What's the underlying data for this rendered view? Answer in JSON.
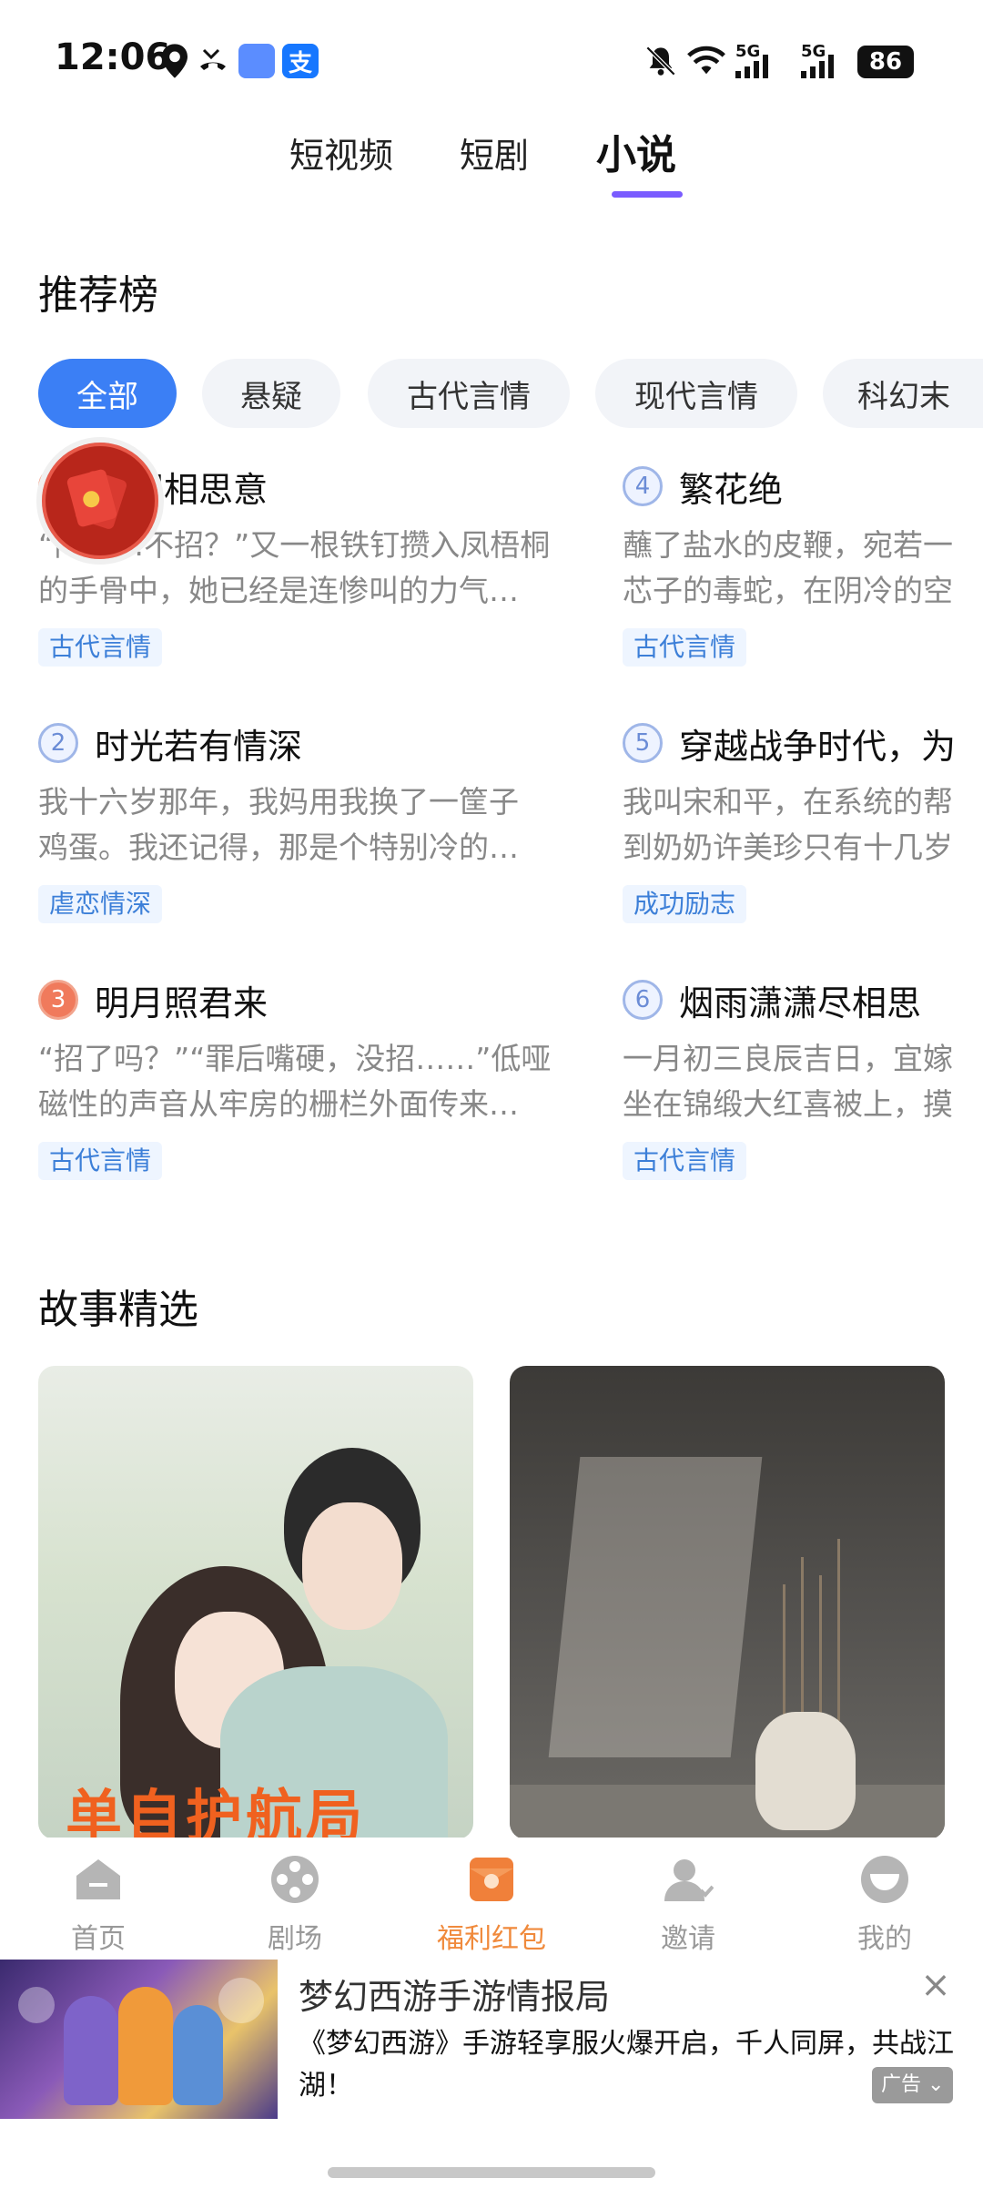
{
  "status_bar": {
    "time": "12:06",
    "net1": "5G",
    "net2": "5G",
    "battery": "86",
    "pay_icon_label": "支"
  },
  "top_tabs": [
    {
      "label": "短视频",
      "active": false
    },
    {
      "label": "短剧",
      "active": false
    },
    {
      "label": "小说",
      "active": true
    }
  ],
  "ranking": {
    "title": "推荐榜",
    "chips": [
      "全部",
      "悬疑",
      "古代言情",
      "现代言情",
      "科幻末"
    ],
    "active_chip": 0,
    "items": [
      {
        "rank": "1",
        "title": "此间相思意",
        "desc": [
          "“问……不招？”又一根铁钉攒入凤梧桐",
          "的手骨中，她已经是连惨叫的力气…"
        ],
        "tag": "古代言情"
      },
      {
        "rank": "2",
        "title": "时光若有情深",
        "desc": [
          "我十六岁那年，我妈用我换了一筐子",
          "鸡蛋。我还记得，那是个特别冷的…"
        ],
        "tag": "虐恋情深"
      },
      {
        "rank": "3",
        "title": "明月照君来",
        "desc": [
          "“招了吗？”“罪后嘴硬，没招……”低哑",
          "磁性的声音从牢房的栅栏外面传来…"
        ],
        "tag": "古代言情"
      },
      {
        "rank": "4",
        "title": "繁花绝",
        "desc": [
          "蘸了盐水的皮鞭，宛若一",
          "芯子的毒蛇，在阴冷的空"
        ],
        "tag": "古代言情"
      },
      {
        "rank": "5",
        "title": "穿越战争时代，为",
        "desc": [
          "我叫宋和平，在系统的帮",
          "到奶奶许美珍只有十几岁"
        ],
        "tag": "成功励志"
      },
      {
        "rank": "6",
        "title": "烟雨潇潇尽相思",
        "desc": [
          "一月初三良辰吉日，宜嫁",
          "坐在锦缎大红喜被上，摸"
        ],
        "tag": "古代言情"
      }
    ]
  },
  "stories": {
    "title": "故事精选",
    "card1_banner": "单自护航局"
  },
  "bottom_nav": [
    {
      "label": "首页",
      "icon": "home-icon",
      "active": false
    },
    {
      "label": "剧场",
      "icon": "film-reel-icon",
      "active": false
    },
    {
      "label": "福利红包",
      "icon": "red-envelope-icon",
      "active": true
    },
    {
      "label": "邀请",
      "icon": "invite-user-icon",
      "active": false
    },
    {
      "label": "我的",
      "icon": "profile-icon",
      "active": false
    }
  ],
  "ad": {
    "title": "梦幻西游手游情报局",
    "text": "《梦幻西游》手游轻享服火爆开启，千人同屏，共战江湖！",
    "badge": "广告"
  },
  "colors": {
    "accent_blue": "#3b7ff5",
    "tab_underline": "#7a5cff",
    "nav_active": "#f08a3c",
    "tag_text": "#3c7fd8"
  }
}
